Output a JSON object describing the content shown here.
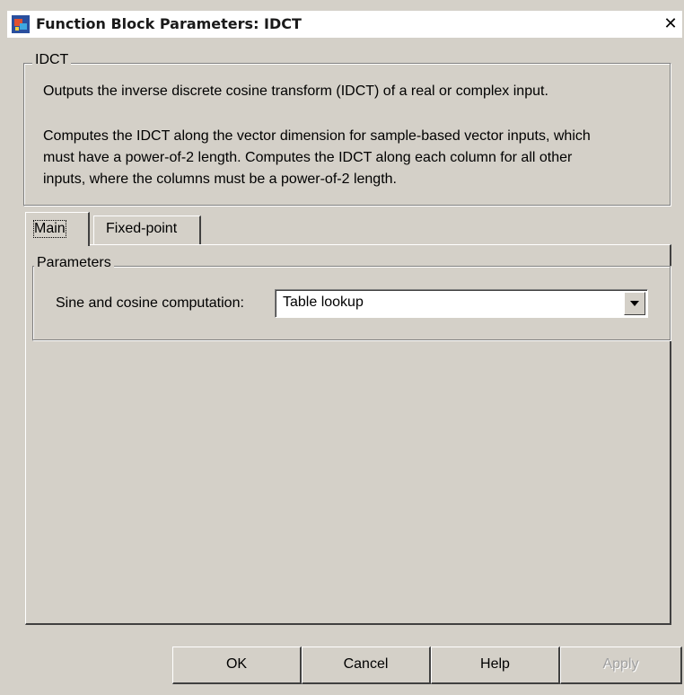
{
  "window": {
    "title": "Function Block Parameters: IDCT",
    "close_glyph": "✕"
  },
  "block": {
    "group_title": "IDCT",
    "description_line1": "Outputs the inverse discrete cosine transform (IDCT) of a real or complex input.",
    "description_line2": "Computes the IDCT along the vector dimension for sample-based vector inputs, which",
    "description_line3": "must have a power-of-2 length. Computes the IDCT along each column for all other",
    "description_line4": "inputs, where the columns must be a power-of-2 length."
  },
  "tabs": [
    {
      "label": "Main",
      "active": true
    },
    {
      "label": "Fixed-point",
      "active": false
    }
  ],
  "parameters": {
    "group_title": "Parameters",
    "sine_cosine_label": "Sine and cosine computation:",
    "sine_cosine_value": "Table lookup"
  },
  "buttons": {
    "ok": "OK",
    "cancel": "Cancel",
    "help": "Help",
    "apply": "Apply"
  },
  "icons": {
    "app": "simulink-block-icon",
    "close": "close-icon",
    "dropdown": "chevron-down-icon"
  }
}
